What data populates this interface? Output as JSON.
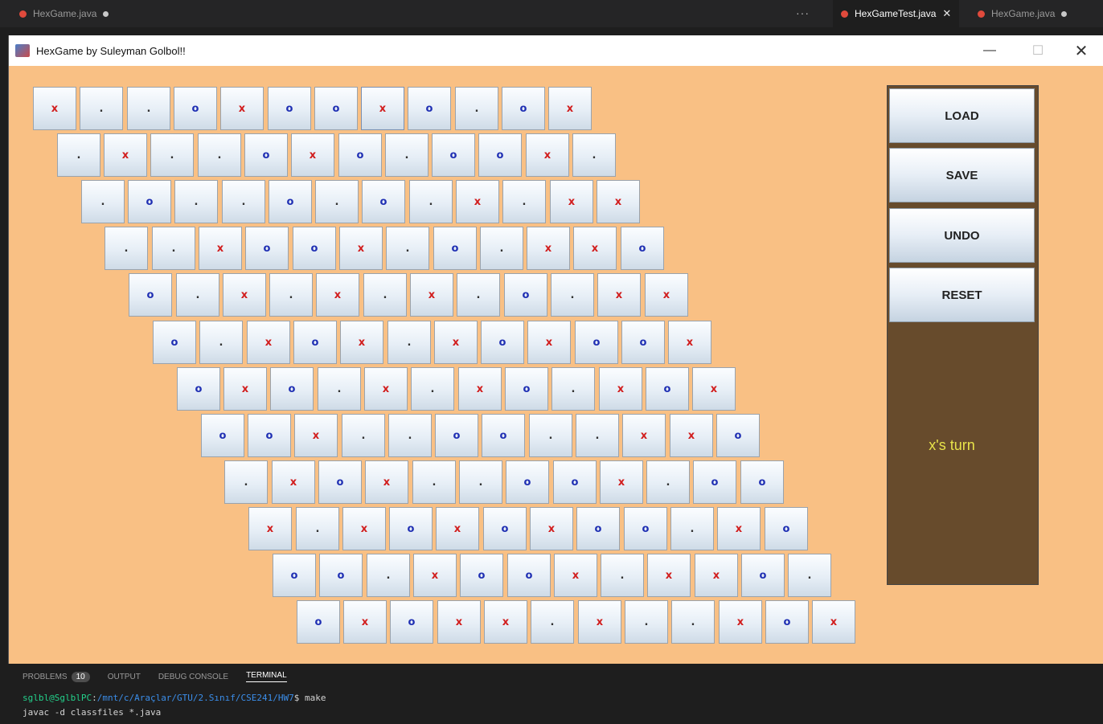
{
  "editor": {
    "tabs": [
      {
        "label": "HexGame.java",
        "active": false,
        "modified": true
      },
      {
        "label": "HexGameTest.java",
        "active": true,
        "modified": false
      },
      {
        "label": "HexGame.java",
        "active": false,
        "modified": true
      }
    ],
    "more_label": "···"
  },
  "window": {
    "title": "HexGame by Suleyman Golbol!!",
    "minimize": "—",
    "maximize": "☐",
    "close": "✕"
  },
  "board": {
    "size": 12,
    "rows": [
      [
        "x",
        ".",
        ".",
        "o",
        "x",
        "o",
        "o",
        "x",
        "o",
        ".",
        "o",
        "x"
      ],
      [
        ".",
        "x",
        ".",
        ".",
        "o",
        "x",
        "o",
        ".",
        "o",
        "o",
        "x",
        "."
      ],
      [
        ".",
        "o",
        ".",
        ".",
        "o",
        ".",
        "o",
        ".",
        "x",
        ".",
        "x",
        "x"
      ],
      [
        ".",
        ".",
        "x",
        "o",
        "o",
        "x",
        ".",
        "o",
        ".",
        "x",
        "x",
        "o"
      ],
      [
        "o",
        ".",
        "x",
        ".",
        "x",
        ".",
        "x",
        ".",
        "o",
        ".",
        "x",
        "x"
      ],
      [
        "o",
        ".",
        "x",
        "o",
        "x",
        ".",
        "x",
        "o",
        "x",
        "o",
        "o",
        "x"
      ],
      [
        "o",
        "x",
        "o",
        ".",
        "x",
        ".",
        "x",
        "o",
        ".",
        "x",
        "o",
        "x"
      ],
      [
        "o",
        "o",
        "x",
        ".",
        ".",
        "o",
        "o",
        ".",
        ".",
        "x",
        "x",
        "o"
      ],
      [
        ".",
        "x",
        "o",
        "x",
        ".",
        ".",
        "o",
        "o",
        "x",
        ".",
        "o",
        "o"
      ],
      [
        "x",
        ".",
        "x",
        "o",
        "x",
        "o",
        "x",
        "o",
        "o",
        ".",
        "x",
        "o"
      ],
      [
        "o",
        "o",
        ".",
        "x",
        "o",
        "o",
        "x",
        ".",
        "x",
        "x",
        "o",
        "."
      ],
      [
        "o",
        "x",
        "o",
        "x",
        "x",
        ".",
        "x",
        ".",
        ".",
        "x",
        "o",
        "x"
      ]
    ]
  },
  "controls": {
    "load": "LOAD",
    "save": "SAVE",
    "undo": "UNDO",
    "reset": "RESET",
    "turn": "x's turn"
  },
  "colors": {
    "window_bg": "#f9c084",
    "side_panel": "#674b2c",
    "x_mark": "#d11d1d",
    "o_mark": "#1f2fb3",
    "turn_text": "#e8e34a"
  },
  "terminal": {
    "tabs": [
      "PROBLEMS",
      "OUTPUT",
      "DEBUG CONSOLE",
      "TERMINAL"
    ],
    "problems_count": "10",
    "prompt_user": "sglbl@SglblPC",
    "prompt_path": "/mnt/c/Araçlar/GTU/2.Sınıf/CSE241/HW7",
    "command": "$ make",
    "line2": "javac -d classfiles *.java"
  }
}
